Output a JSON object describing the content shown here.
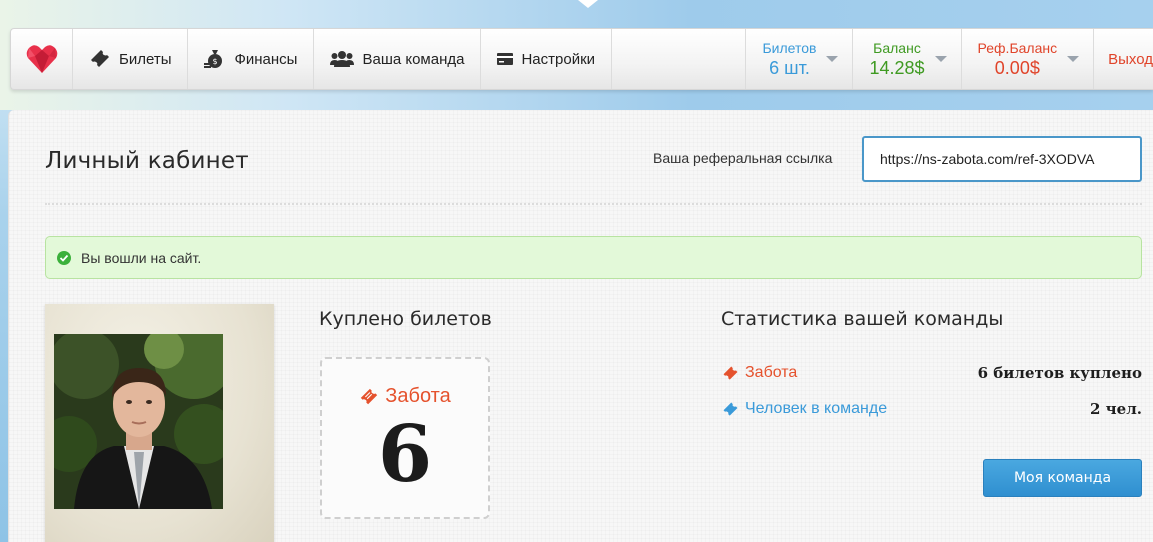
{
  "nav": {
    "logo_icon": "heart-logo-icon",
    "items": [
      {
        "label": "Билеты",
        "icon": "ticket-icon"
      },
      {
        "label": "Финансы",
        "icon": "money-bag-icon"
      },
      {
        "label": "Ваша команда",
        "icon": "team-icon"
      },
      {
        "label": "Настройки",
        "icon": "card-icon"
      }
    ],
    "stats": [
      {
        "label": "Билетов",
        "value": "6 шт.",
        "color": "#3a9ad9"
      },
      {
        "label": "Баланс",
        "value": "14.28$",
        "color": "#3f9a22"
      },
      {
        "label": "Реф.Баланс",
        "value": "0.00$",
        "color": "#e0442a"
      }
    ],
    "logout_label": "Выход"
  },
  "page": {
    "title": "Личный кабинет",
    "ref_label": "Ваша реферальная ссылка",
    "ref_link": "https://ns-zabota.com/ref-3XODVA",
    "alert": "Вы вошли на сайт."
  },
  "tickets": {
    "heading": "Куплено билетов",
    "name": "Забота",
    "count": "6"
  },
  "team": {
    "heading": "Статистика вашей команды",
    "rows": [
      {
        "label": "Забота",
        "value": "6 билетов куплено",
        "color": "#e5522d",
        "icon": "ticket-icon"
      },
      {
        "label": "Человек в команде",
        "value": "2 чел.",
        "color": "#3a9ad9",
        "icon": "ticket-icon"
      }
    ],
    "button_label": "Моя команда"
  },
  "colors": {
    "accent_blue": "#3a9ad9",
    "accent_green": "#3f9a22",
    "accent_red": "#e0442a",
    "alert_bg": "#e3f9d9"
  }
}
